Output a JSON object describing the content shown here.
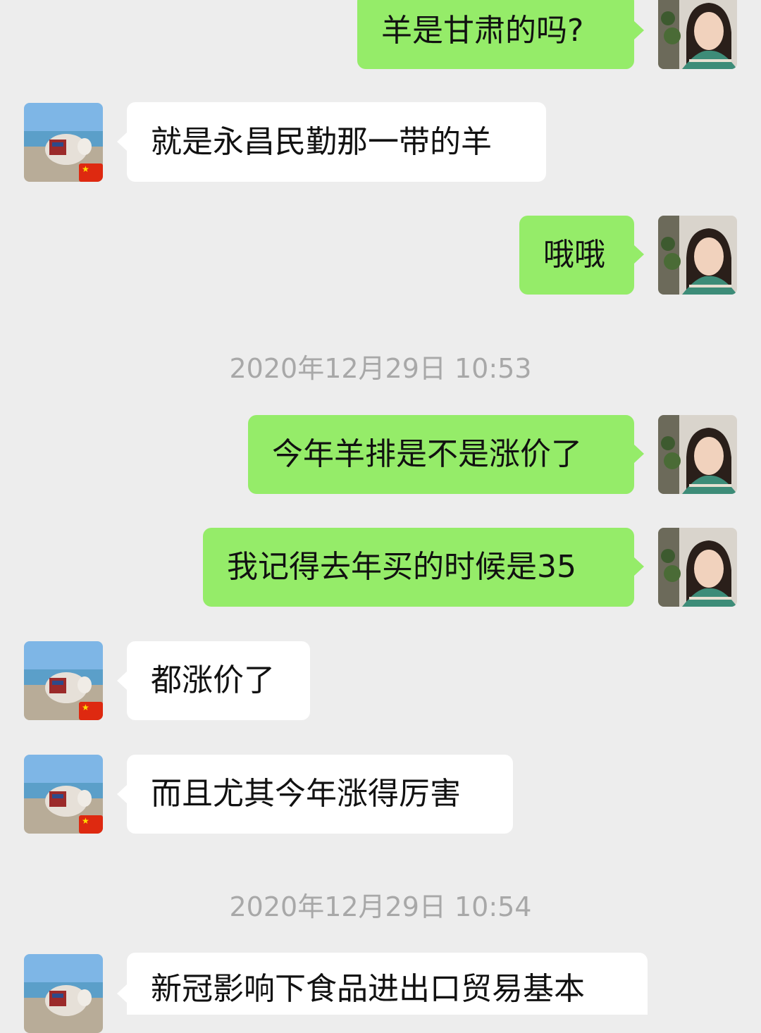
{
  "chat": {
    "messages": [
      {
        "side": "me",
        "text": "羊是甘肃的吗?"
      },
      {
        "side": "other",
        "text": "就是永昌民勤那一带的羊"
      },
      {
        "side": "me",
        "text": "哦哦"
      },
      {
        "side": "me",
        "text": "今年羊排是不是涨价了"
      },
      {
        "side": "me",
        "text": "我记得去年买的时候是35"
      },
      {
        "side": "other",
        "text": "都涨价了"
      },
      {
        "side": "other",
        "text": "而且尤其今年涨得厉害"
      },
      {
        "side": "other",
        "text": "新冠影响下食品进出口贸易基本"
      }
    ],
    "timestamps": [
      "2020年12月29日 10:53",
      "2020年12月29日 10:54"
    ]
  },
  "colors": {
    "background": "#ededed",
    "my_bubble": "#95ec69",
    "other_bubble": "#ffffff",
    "timestamp_text": "#a8a8a8"
  },
  "icons": {
    "me_avatar": "woman-portrait-avatar",
    "other_avatar": "yak-photo-avatar",
    "flag_badge": "china-flag-icon"
  }
}
